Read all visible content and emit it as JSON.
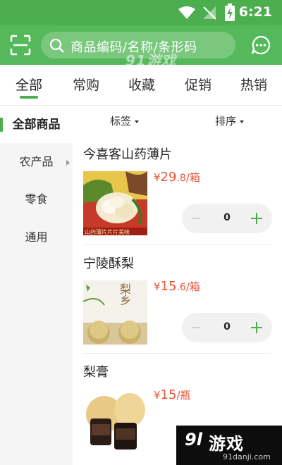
{
  "status_bar": {
    "time": "6:21"
  },
  "header": {
    "search_placeholder": "商品编码/名称/条形码",
    "watermark": "91游戏"
  },
  "tabs": [
    {
      "label": "全部",
      "active": true
    },
    {
      "label": "常购",
      "active": false
    },
    {
      "label": "收藏",
      "active": false
    },
    {
      "label": "促销",
      "active": false
    },
    {
      "label": "热销",
      "active": false
    }
  ],
  "sidebar": {
    "items": [
      {
        "label": "全部商品",
        "active": true
      },
      {
        "label": "农产品",
        "active": false
      },
      {
        "label": "零食",
        "active": false
      },
      {
        "label": "通用",
        "active": false
      }
    ]
  },
  "filters": {
    "tag_label": "标签",
    "sort_label": "排序"
  },
  "products": [
    {
      "name": "今喜客山药薄片",
      "price_symbol": "¥",
      "price_int": "29",
      "price_dec": ".8",
      "unit": "/箱",
      "qty": "0",
      "image_caption": "山药薄片片片美味"
    },
    {
      "name": "宁陵酥梨",
      "price_symbol": "¥",
      "price_int": "15",
      "price_dec": ".6",
      "unit": "/箱",
      "qty": "0",
      "image_caption": "梨乡"
    },
    {
      "name": "梨膏",
      "price_symbol": "¥",
      "price_int": "15",
      "price_dec": "",
      "unit": "/瓶",
      "qty": "0"
    }
  ],
  "watermark_bottom": {
    "logo": "9l",
    "title": "游戏",
    "site": "91danji.com"
  },
  "colors": {
    "primary": "#4cae4f",
    "price": "#e8553b"
  }
}
